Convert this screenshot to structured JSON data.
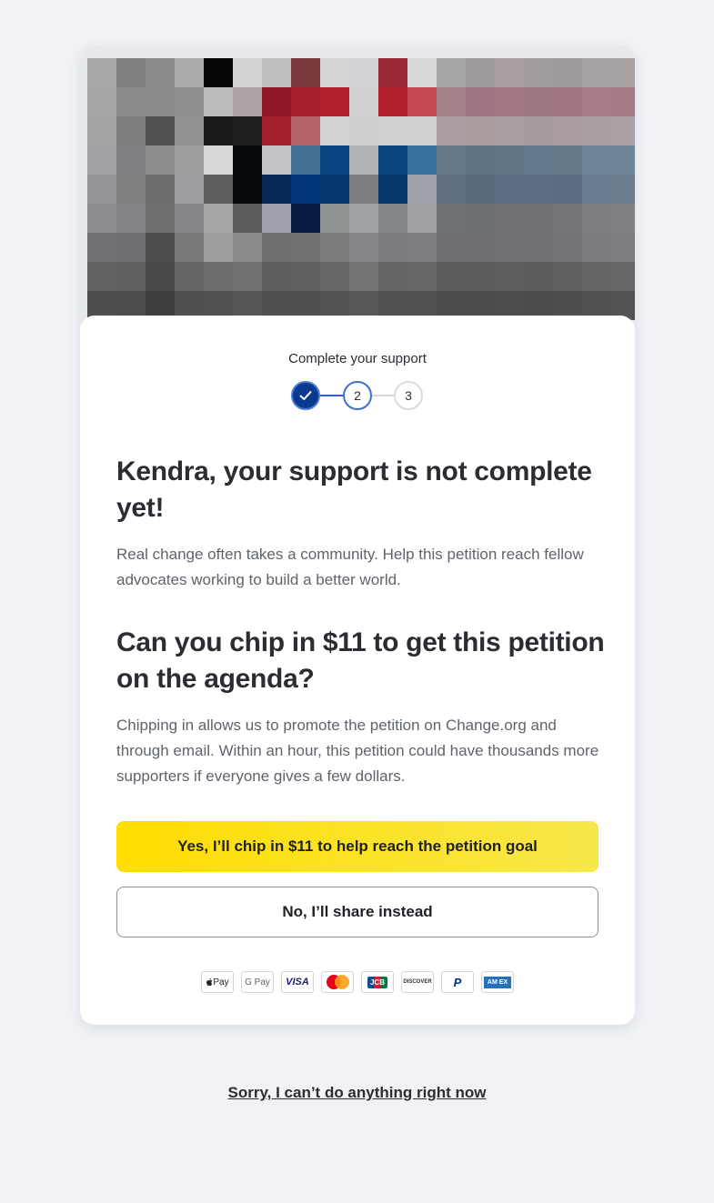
{
  "hero": {
    "image_alt": "petition-image",
    "mosaic_colors": [
      "#a7a9ab",
      "#7f8082",
      "#8a8b8d",
      "#a9aaab",
      "#050505",
      "#d2d4d4",
      "#bdbebf",
      "#7b3a3f",
      "#d5d3d5",
      "#d2d3d6",
      "#992832",
      "#d6d8d8",
      "#a6a6a6",
      "#a09b9b",
      "#a79f9f",
      "#a19c9c",
      "#a09b9b",
      "#a9a2a2",
      "#a9a2a2",
      "#a4a6a8",
      "#898a8c",
      "#8a8b8d",
      "#8d8e90",
      "#bbbcbd",
      "#ada2a5",
      "#8d1824",
      "#a61e2c",
      "#b4212e",
      "#d0d1d3",
      "#af1f2c",
      "#c34955",
      "#a18288",
      "#a07480",
      "#a47a82",
      "#a07880",
      "#a17880",
      "#a87c86",
      "#a67a84",
      "#a2a4a6",
      "#7d7e80",
      "#505254",
      "#8f9092",
      "#1b1b1c",
      "#1e1d20",
      "#a31f2b",
      "#b56268",
      "#d2d3d5",
      "#cccecf",
      "#d0d1d3",
      "#d0d1d3",
      "#a99d9f",
      "#a99a9c",
      "#a89d9f",
      "#a59a9c",
      "#a89c9e",
      "#a8a0a2",
      "#aaa2a4",
      "#9fa1a4",
      "#808184",
      "#8b8c8e",
      "#9c9d9f",
      "#d6d7d8",
      "#05080d",
      "#c1c3c6",
      "#456f93",
      "#0a4380",
      "#b1b4b8",
      "#0b447d",
      "#3a709c",
      "#647a8a",
      "#5f7585",
      "#617788",
      "#637b8c",
      "#647a8a",
      "#6d8396",
      "#6e8599",
      "#949699",
      "#7e8082",
      "#6a6c6e",
      "#9c9ea1",
      "#5d5e60",
      "#060a0f",
      "#062655",
      "#00357a",
      "#06386f",
      "#7b7d80",
      "#063a6b",
      "#a0a3ab",
      "#617081",
      "#5b697d",
      "#5e6d82",
      "#5e6d81",
      "#5d6b80",
      "#677a90",
      "#6d7d90",
      "#8a8c8f",
      "#828487",
      "#6d6f71",
      "#85878a",
      "#a6a7a9",
      "#5a5b5d",
      "#9ea3ae",
      "#051b40",
      "#8f9394",
      "#9fa2a5",
      "#84878a",
      "#9d9fa3",
      "#6f7275",
      "#6c6f72",
      "#6f7174",
      "#6f7174",
      "#737578",
      "#7c7e81",
      "#7e8083",
      "#6f7174",
      "#6e7073",
      "#4a4c4e",
      "#757779",
      "#9b9d9f",
      "#888a8b",
      "#6d6f71",
      "#707274",
      "#7a7c7e",
      "#85878a",
      "#7a7c7f",
      "#7b7d80",
      "#6d6f72",
      "#6d6f72",
      "#6f7174",
      "#6f7174",
      "#717376",
      "#7a7c7f",
      "#7b7d80",
      "#606264",
      "#5f6163",
      "#474849",
      "#626466",
      "#6a6c6e",
      "#707274",
      "#5b5d5f",
      "#5e6062",
      "#646668",
      "#717375",
      "#626466",
      "#646668",
      "#5a5c5e",
      "#5a5c5e",
      "#5c5e60",
      "#5a5c5e",
      "#5f6163",
      "#636567",
      "#646668",
      "#4d4e50",
      "#4c4d4f",
      "#3d3e40",
      "#4f5052",
      "#515254",
      "#545557",
      "#4e4f51",
      "#4f5052",
      "#525355",
      "#57585a",
      "#505153",
      "#515254",
      "#4a4b4d",
      "#4a4b4d",
      "#4b4c4e",
      "#4a4b4d",
      "#4d4e50",
      "#505153",
      "#525355"
    ]
  },
  "stepper": {
    "label": "Complete your support",
    "steps": [
      "✓",
      "2",
      "3"
    ]
  },
  "content": {
    "headline": "Kendra, your support is not complete yet!",
    "intro": "Real change often takes a community. Help this petition reach fellow advocates working to build a better world.",
    "ask_headline": "Can you chip in $11 to get this petition on the agenda?",
    "ask_body": "Chipping in allows us to promote the petition on Change.org and through email. Within an hour, this petition could have thousands more supporters if everyone gives a few dollars."
  },
  "actions": {
    "yes_label": "Yes, I’ll chip in $11 to help reach the petition goal",
    "no_label": "No, I’ll share instead",
    "decline_label": "Sorry, I can’t do anything right now"
  },
  "payment_methods": [
    {
      "icon": "apple-pay-icon",
      "label": "Pay"
    },
    {
      "icon": "google-pay-icon",
      "label": "G Pay"
    },
    {
      "icon": "visa-icon",
      "label": "VISA"
    },
    {
      "icon": "mastercard-icon",
      "label": ""
    },
    {
      "icon": "jcb-icon",
      "label": "JCB"
    },
    {
      "icon": "discover-icon",
      "label": "DISCOVER"
    },
    {
      "icon": "paypal-icon",
      "label": "P"
    },
    {
      "icon": "amex-icon",
      "label": "AM EX"
    }
  ],
  "colors": {
    "accent_yellow": "#ffdd00",
    "stepper_blue": "#0a3a8f",
    "background": "#f0f2f7"
  }
}
